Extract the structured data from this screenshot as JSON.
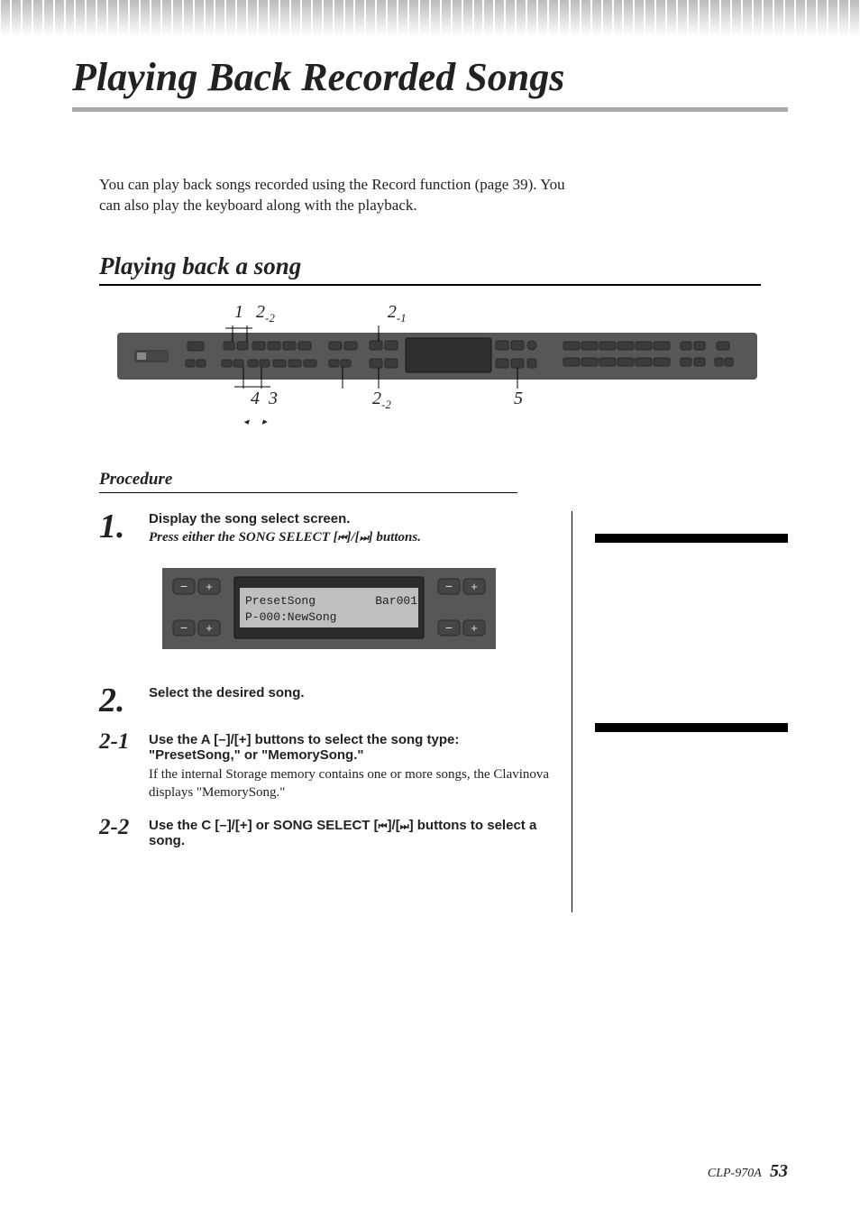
{
  "page": {
    "title": "Playing Back Recorded Songs",
    "intro": "You can play back songs recorded using the Record function (page 39). You can also play the keyboard along with the playback.",
    "section_heading": "Playing back a song",
    "procedure_label": "Procedure",
    "footer_model": "CLP-970A",
    "footer_page": "53"
  },
  "callouts": {
    "top_1": "1",
    "top_2_2": "2",
    "top_2_2_sub": "-2",
    "top_2_1": "2",
    "top_2_1_sub": "-1",
    "bottom_4": "4",
    "bottom_3": "3",
    "bottom_2_2": "2",
    "bottom_2_2_sub": "-2",
    "bottom_5": "5",
    "bottom_tri_left": "◂",
    "bottom_tri_right": "▸"
  },
  "lcd": {
    "line1": "PresetSong",
    "line1_right": "Bar001",
    "line2": "P-000:NewSong"
  },
  "steps": {
    "s1_num": "1.",
    "s1_title": "Display the song select screen.",
    "s1_instr_a": "Press either the SONG SELECT [",
    "s1_instr_b": "]/[",
    "s1_instr_c": "] buttons.",
    "rew_icon": "⏮",
    "ff_icon": "⏭",
    "s2_num": "2.",
    "s2_title": "Select the desired song.",
    "s2_1_num": "2-1",
    "s2_1_title": "Use the A [–]/[+] buttons to select the song type: \"PresetSong,\" or \"MemorySong.\"",
    "s2_1_detail": "If the internal Storage memory contains one or more songs, the Clavinova displays \"MemorySong.\"",
    "s2_2_num": "2-2",
    "s2_2_title_a": "Use the C [–]/[+] or SONG SELECT [",
    "s2_2_title_b": "]/[",
    "s2_2_title_c": "] buttons to select a song."
  }
}
